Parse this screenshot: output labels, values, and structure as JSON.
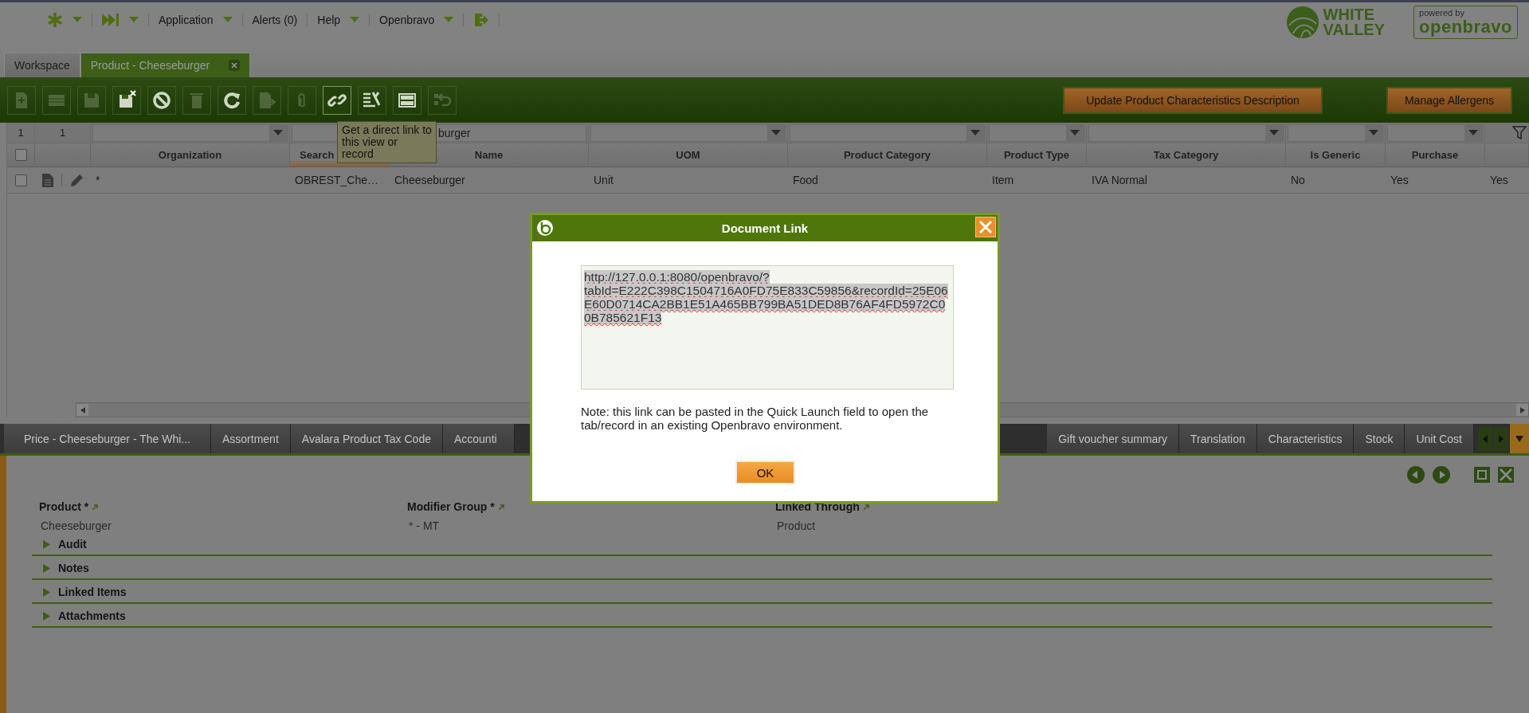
{
  "top_nav": [
    {
      "kind": "icon",
      "caret": true
    },
    {
      "kind": "icon",
      "caret": true
    },
    {
      "kind": "text",
      "label": "Application",
      "caret": true
    },
    {
      "kind": "text",
      "label": "Alerts (0)",
      "caret": false
    },
    {
      "kind": "text",
      "label": "Help",
      "caret": true
    },
    {
      "kind": "text",
      "label": "Openbravo",
      "caret": true
    },
    {
      "kind": "icon",
      "caret": false
    }
  ],
  "logos": {
    "white_valley": [
      "WHITE",
      "VALLEY"
    ],
    "powered_by": "powered by",
    "openbravo": "openbravo"
  },
  "window_tabs": [
    {
      "label": "Workspace",
      "selected": false,
      "closable": false
    },
    {
      "label": "Product - Cheeseburger",
      "selected": true,
      "closable": true
    }
  ],
  "toolbar": {
    "buttons": [
      {
        "disabled": true,
        "highlighted": false
      },
      {
        "disabled": true,
        "highlighted": false
      },
      {
        "disabled": true,
        "highlighted": false
      },
      {
        "disabled": false,
        "highlighted": false
      },
      {
        "disabled": false,
        "highlighted": false
      },
      {
        "disabled": true,
        "highlighted": false
      },
      {
        "disabled": false,
        "highlighted": false
      },
      {
        "disabled": true,
        "highlighted": false
      },
      {
        "disabled": true,
        "highlighted": false
      },
      {
        "disabled": false,
        "highlighted": true
      },
      {
        "disabled": false,
        "highlighted": false
      },
      {
        "disabled": false,
        "highlighted": false
      },
      {
        "disabled": true,
        "highlighted": false
      }
    ],
    "actions": [
      "Update Product Characteristics Description",
      "Manage Allergens"
    ]
  },
  "tooltip": "Get a direct link to this view or record",
  "grid": {
    "counts": [
      "1",
      "1"
    ],
    "columns": [
      {
        "label": "Organization",
        "kind": "select",
        "sorted": false
      },
      {
        "label": "Search",
        "kind": "text",
        "sorted": true
      },
      {
        "label": "Name",
        "kind": "text",
        "sorted": false,
        "filter_value": "burger"
      },
      {
        "label": "UOM",
        "kind": "select",
        "sorted": false
      },
      {
        "label": "Product Category",
        "kind": "select",
        "sorted": false
      },
      {
        "label": "Product Type",
        "kind": "select",
        "sorted": false
      },
      {
        "label": "Tax Category",
        "kind": "select",
        "sorted": false
      },
      {
        "label": "Is Generic",
        "kind": "select",
        "sorted": false
      },
      {
        "label": "Purchase",
        "kind": "select",
        "sorted": false
      },
      {
        "kind": "funnel",
        "sorted": false
      }
    ],
    "header_checked": false,
    "rows": [
      {
        "checked": false,
        "cells": [
          "*",
          "OBREST_Che…",
          "Cheeseburger",
          "Unit",
          "Food",
          "Item",
          "IVA Normal",
          "No",
          "Yes",
          "Yes"
        ]
      }
    ]
  },
  "sub_tabs": {
    "left": [
      "Price - Cheeseburger - The Whi...",
      "Assortment",
      "Avalara Product Tax Code",
      "Accounti"
    ],
    "right": [
      "Gift voucher summary",
      "Translation",
      "Characteristics",
      "Stock",
      "Unit Cost"
    ]
  },
  "form": {
    "fields": [
      {
        "label": "Product *",
        "value": "Cheeseburger"
      },
      {
        "label": "Modifier Group *",
        "value": "* - MT"
      },
      {
        "label": "Linked Through",
        "value": "Product"
      }
    ],
    "sections": [
      {
        "label": "Audit",
        "expanded": false
      },
      {
        "label": "Notes",
        "expanded": false
      },
      {
        "label": "Linked Items",
        "expanded": false
      },
      {
        "label": "Attachments",
        "expanded": false
      }
    ]
  },
  "dialog": {
    "title": "Document Link",
    "link": "http://127.0.0.1:8080/openbravo/?tabId=E222C398C1504716A0FD75E833C59856&recordId=25E06E60D0714CA2BB1E51A465BB799BA51DED8B76AF4FD5972C00B785621F13",
    "note": "Note: this link can be pasted in the Quick Launch field to open the tab/record in an existing Openbravo environment.",
    "ok": "OK"
  }
}
